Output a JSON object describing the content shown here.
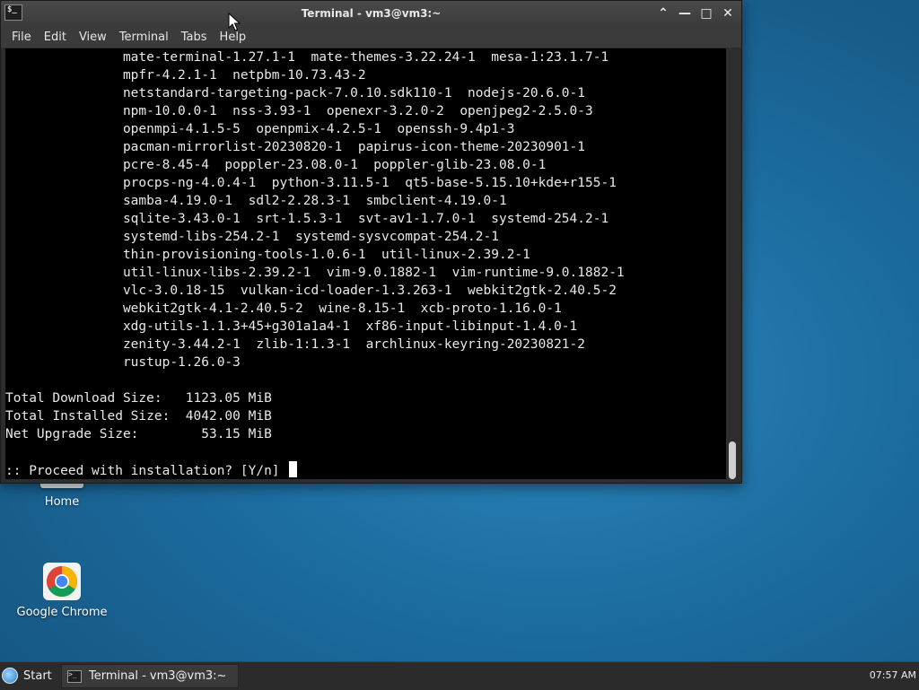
{
  "desktop": {
    "icons": [
      {
        "label": "Home"
      },
      {
        "label": "Google Chrome"
      }
    ]
  },
  "window": {
    "title": "Terminal - vm3@vm3:~",
    "menu": [
      "File",
      "Edit",
      "View",
      "Terminal",
      "Tabs",
      "Help"
    ],
    "buttons": {
      "maximize_up": "⌃",
      "minimize": "—",
      "restore": "□",
      "close": "✕"
    }
  },
  "terminal": {
    "lines": [
      "               mate-terminal-1.27.1-1  mate-themes-3.22.24-1  mesa-1:23.1.7-1",
      "               mpfr-4.2.1-1  netpbm-10.73.43-2",
      "               netstandard-targeting-pack-7.0.10.sdk110-1  nodejs-20.6.0-1",
      "               npm-10.0.0-1  nss-3.93-1  openexr-3.2.0-2  openjpeg2-2.5.0-3",
      "               openmpi-4.1.5-5  openpmix-4.2.5-1  openssh-9.4p1-3",
      "               pacman-mirrorlist-20230820-1  papirus-icon-theme-20230901-1",
      "               pcre-8.45-4  poppler-23.08.0-1  poppler-glib-23.08.0-1",
      "               procps-ng-4.0.4-1  python-3.11.5-1  qt5-base-5.15.10+kde+r155-1",
      "               samba-4.19.0-1  sdl2-2.28.3-1  smbclient-4.19.0-1",
      "               sqlite-3.43.0-1  srt-1.5.3-1  svt-av1-1.7.0-1  systemd-254.2-1",
      "               systemd-libs-254.2-1  systemd-sysvcompat-254.2-1",
      "               thin-provisioning-tools-1.0.6-1  util-linux-2.39.2-1",
      "               util-linux-libs-2.39.2-1  vim-9.0.1882-1  vim-runtime-9.0.1882-1",
      "               vlc-3.0.18-15  vulkan-icd-loader-1.3.263-1  webkit2gtk-2.40.5-2",
      "               webkit2gtk-4.1-2.40.5-2  wine-8.15-1  xcb-proto-1.16.0-1",
      "               xdg-utils-1.1.3+45+g301a1a4-1  xf86-input-libinput-1.4.0-1",
      "               zenity-3.44.2-1  zlib-1:1.3-1  archlinux-keyring-20230821-2",
      "               rustup-1.26.0-3",
      "",
      "Total Download Size:   1123.05 MiB",
      "Total Installed Size:  4042.00 MiB",
      "Net Upgrade Size:        53.15 MiB",
      ""
    ],
    "prompt": ":: Proceed with installation? [Y/n] "
  },
  "taskbar": {
    "start_label": "Start",
    "task_label": "Terminal - vm3@vm3:~",
    "clock": "07:57 AM"
  }
}
